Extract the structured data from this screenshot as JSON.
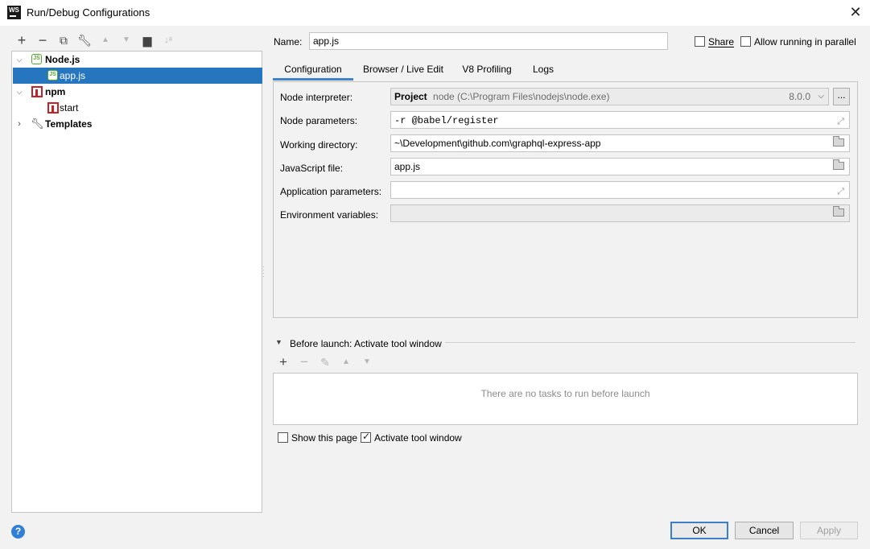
{
  "window": {
    "title": "Run/Debug Configurations",
    "app_logo": "WS",
    "close_icon": "close-icon"
  },
  "toolbar": {
    "icons": [
      "add-icon",
      "remove-icon",
      "copy-icon",
      "wrench-icon",
      "move-up-icon",
      "move-down-icon",
      "new-folder-icon",
      "sort-icon"
    ]
  },
  "tree": {
    "items": [
      {
        "label": "Node.js",
        "icon": "nodejs-icon",
        "expanded": true
      },
      {
        "label": "app.js",
        "icon": "nodejs-icon",
        "selected": true
      },
      {
        "label": "npm",
        "icon": "npm-icon",
        "expanded": true
      },
      {
        "label": "start",
        "icon": "npm-icon"
      },
      {
        "label": "Templates",
        "icon": "wrench-icon",
        "expanded": false
      }
    ]
  },
  "header": {
    "name_label": "Name:",
    "name_value": "app.js",
    "share_label": "Share",
    "share_checked": false,
    "parallel_label": "Allow running in parallel",
    "parallel_checked": false
  },
  "tabs": [
    {
      "label": "Configuration",
      "active": true
    },
    {
      "label": "Browser / Live Edit"
    },
    {
      "label": "V8 Profiling"
    },
    {
      "label": "Logs"
    }
  ],
  "config": {
    "interpreter": {
      "label": "Node interpreter:",
      "kind": "Project",
      "path": "node (C:\\Program Files\\nodejs\\node.exe)",
      "version": "8.0.0",
      "browse": "..."
    },
    "node_params": {
      "label": "Node parameters:",
      "value": "-r @babel/register"
    },
    "working_dir": {
      "label": "Working directory:",
      "value": "~\\Development\\github.com\\graphql-express-app"
    },
    "js_file": {
      "label": "JavaScript file:",
      "value": "app.js"
    },
    "app_params": {
      "label": "Application parameters:",
      "value": ""
    },
    "env_vars": {
      "label": "Environment variables:",
      "value": ""
    }
  },
  "before_launch": {
    "title": "Before launch: Activate tool window",
    "empty_text": "There are no tasks to run before launch",
    "show_page_label": "Show this page",
    "show_page_checked": false,
    "activate_label": "Activate tool window",
    "activate_checked": true
  },
  "buttons": {
    "ok": "OK",
    "cancel": "Cancel",
    "apply": "Apply",
    "help": "?"
  },
  "colors": {
    "selection": "#2675bf",
    "accent": "#4083c9",
    "node_green": "#55a630",
    "npm_red": "#c12127"
  }
}
